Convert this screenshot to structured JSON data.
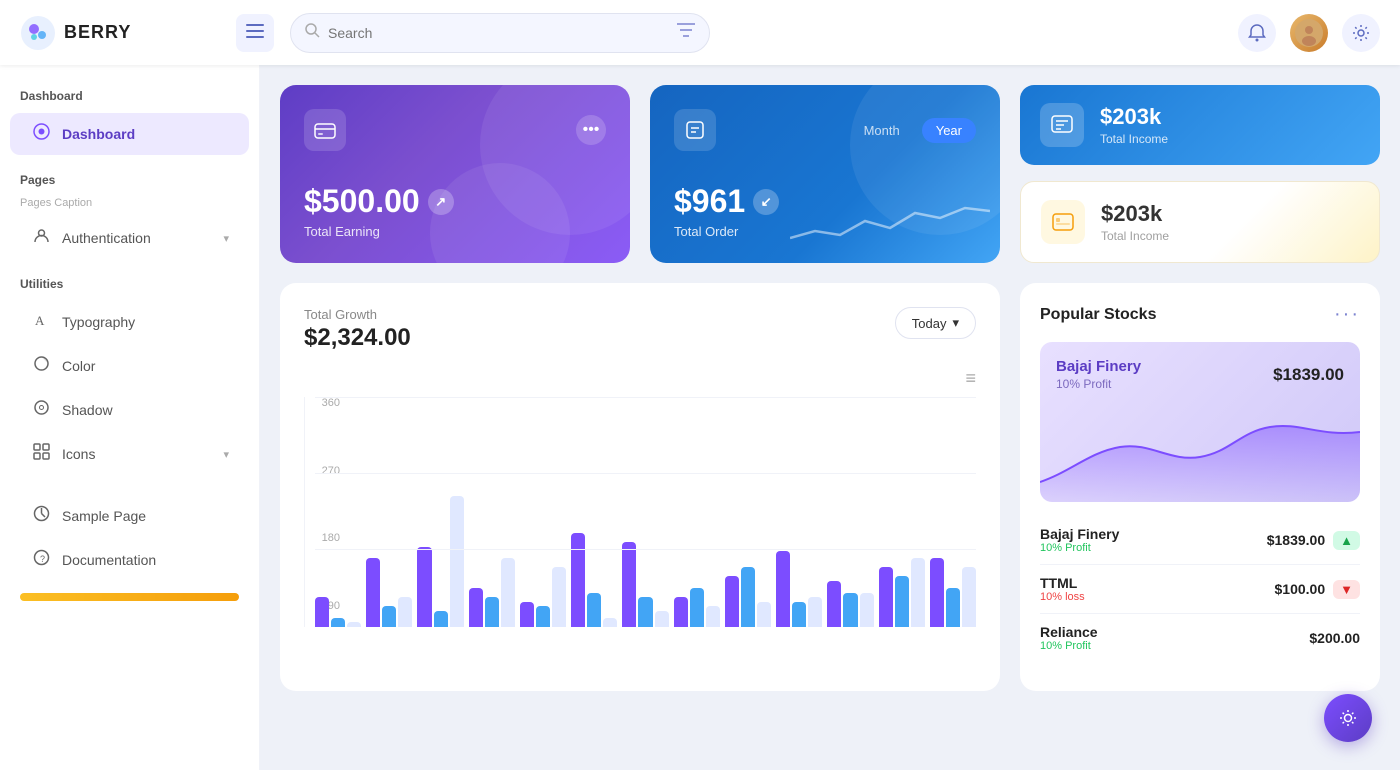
{
  "header": {
    "logo_text": "BERRY",
    "search_placeholder": "Search",
    "menu_icon": "☰",
    "bell_icon": "🔔",
    "gear_icon": "⚙️",
    "avatar_emoji": "👤"
  },
  "sidebar": {
    "dashboard_section": "Dashboard",
    "dashboard_item": "Dashboard",
    "pages_section": "Pages",
    "pages_caption": "Pages Caption",
    "authentication_item": "Authentication",
    "utilities_section": "Utilities",
    "typography_item": "Typography",
    "color_item": "Color",
    "shadow_item": "Shadow",
    "icons_item": "Icons",
    "sample_page_item": "Sample Page",
    "documentation_item": "Documentation"
  },
  "cards": {
    "earning": {
      "amount": "$500.00",
      "label": "Total Earning",
      "icon": "💳",
      "arrow_icon": "↗"
    },
    "order": {
      "amount": "$961",
      "label": "Total Order",
      "tab_month": "Month",
      "tab_year": "Year",
      "icon": "🛍️",
      "arrow_icon": "↙"
    },
    "total_income_blue": {
      "amount": "$203k",
      "label": "Total Income",
      "icon": "📊"
    },
    "total_income_yellow": {
      "amount": "$203k",
      "label": "Total Income",
      "icon": "🏪"
    }
  },
  "chart": {
    "title": "Total Growth",
    "amount": "$2,324.00",
    "period_label": "Today",
    "y_labels": [
      "360",
      "270",
      "180",
      "90"
    ],
    "menu_icon": "≡",
    "bars": [
      {
        "purple": 30,
        "blue": 10,
        "light": 5
      },
      {
        "purple": 70,
        "blue": 20,
        "light": 30
      },
      {
        "purple": 80,
        "blue": 15,
        "light": 70
      },
      {
        "purple": 40,
        "blue": 30,
        "light": 130
      },
      {
        "purple": 25,
        "blue": 20,
        "light": 60
      },
      {
        "purple": 95,
        "blue": 35,
        "light": 10
      },
      {
        "purple": 85,
        "blue": 30,
        "light": 15
      },
      {
        "purple": 30,
        "blue": 40,
        "light": 20
      },
      {
        "purple": 50,
        "blue": 60,
        "light": 25
      },
      {
        "purple": 75,
        "blue": 25,
        "light": 30
      },
      {
        "purple": 45,
        "blue": 35,
        "light": 35
      },
      {
        "purple": 60,
        "blue": 50,
        "light": 70
      },
      {
        "purple": 70,
        "blue": 40,
        "light": 60
      }
    ]
  },
  "stocks": {
    "title": "Popular Stocks",
    "more_icon": "•••",
    "featured": {
      "name": "Bajaj Finery",
      "price": "$1839.00",
      "profit": "10% Profit"
    },
    "list": [
      {
        "name": "Bajaj Finery",
        "sub": "10% Profit",
        "sub_type": "green",
        "price": "$1839.00",
        "badge": "up"
      },
      {
        "name": "TTML",
        "sub": "10% loss",
        "sub_type": "red",
        "price": "$100.00",
        "badge": "down"
      },
      {
        "name": "Reliance",
        "sub": "10% Profit",
        "sub_type": "green",
        "price": "$200.00",
        "badge": "up"
      }
    ]
  },
  "floating_gear": "⚙"
}
